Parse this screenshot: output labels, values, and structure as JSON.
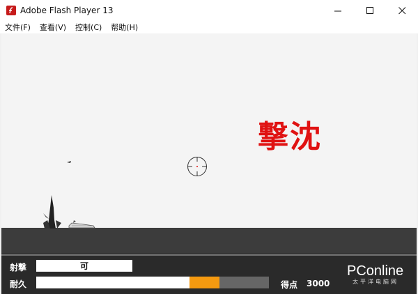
{
  "window": {
    "title": "Adobe Flash Player 13",
    "icon": "flash-player-icon"
  },
  "menu": [
    "文件(F)",
    "查看(V)",
    "控制(C)",
    "帮助(H)"
  ],
  "game": {
    "sunk_text": "撃沈",
    "fire_label": "射撃",
    "fire_status": "可",
    "durability_label": "耐久",
    "durability_fraction": 0.66,
    "damage_fraction": 0.13,
    "score_label": "得点",
    "score_value": "3000"
  },
  "watermark": {
    "main": "PConline",
    "sub": "太平洋电脑网"
  },
  "colors": {
    "ground": "#3c3c3c",
    "hud": "#2a2a2a",
    "sunk_text": "#e01212",
    "damage": "#f59a10"
  }
}
